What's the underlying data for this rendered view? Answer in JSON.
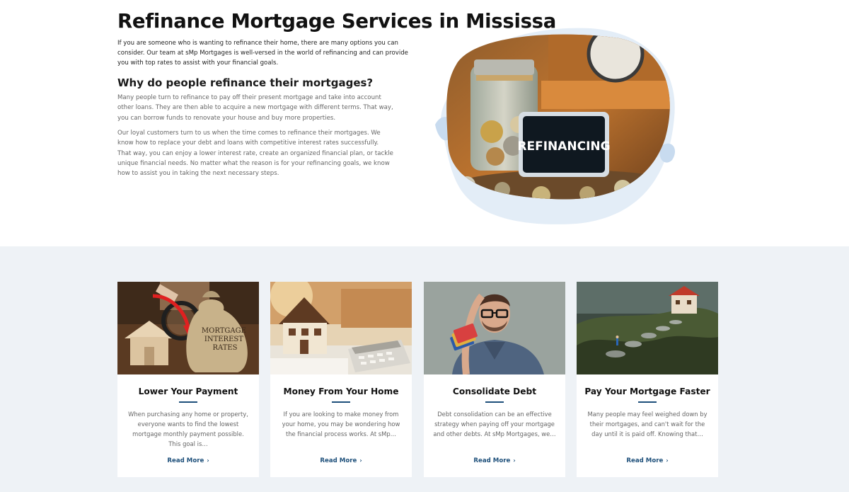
{
  "hero": {
    "title": "Refinance Mortgage Services in Mississauga",
    "intro": "If you are someone who is wanting to refinance their home, there are many options you can consider. Our team at sMp Mortgages is well-versed in the world of refinancing and can provide you with top rates to assist with your financial goals.",
    "subtitle": "Why do people refinance their mortgages?",
    "para1": "Many people turn to refinance to pay off their present mortgage and take into account other loans. They are then able to acquire a new mortgage with different terms. That way, you can borrow funds to renovate your house and buy more properties.",
    "para2": "Our loyal customers turn to us when the time comes to refinance their mortgages. We know how to replace your debt and loans with competitive interest rates successfully. That way, you can enjoy a lower interest rate, create an organized financial plan, or tackle unique financial needs. No matter what the reason is for your refinancing goals, we know how to assist you in taking the next necessary steps.",
    "image_sign_text": "REFINANCING"
  },
  "cards": [
    {
      "title": "Lower Your Payment",
      "desc": "When purchasing any home or property, everyone wants to find the lowest mortgage monthly payment possible. This goal is…",
      "link": "Read More",
      "bag_text": "MORTGAGE INTEREST RATES"
    },
    {
      "title": "Money From Your Home",
      "desc": "If you are looking to make money from your home, you may be wondering how the financial process works. At sMp…",
      "link": "Read More"
    },
    {
      "title": "Consolidate Debt",
      "desc": "Debt consolidation can be an effective strategy when paying off your mortgage and other debts. At sMp Mortgages, we…",
      "link": "Read More"
    },
    {
      "title": "Pay Your Mortgage Faster",
      "desc": "Many people may feel weighed down by their mortgages, and can't wait for the day until it is paid off. Knowing that…",
      "link": "Read More"
    }
  ],
  "colors": {
    "accent": "#1d4f7a",
    "section_bg": "#eef2f6",
    "blob": "#dce8f5"
  },
  "icons": {
    "read_more": "chevron-right-icon"
  }
}
